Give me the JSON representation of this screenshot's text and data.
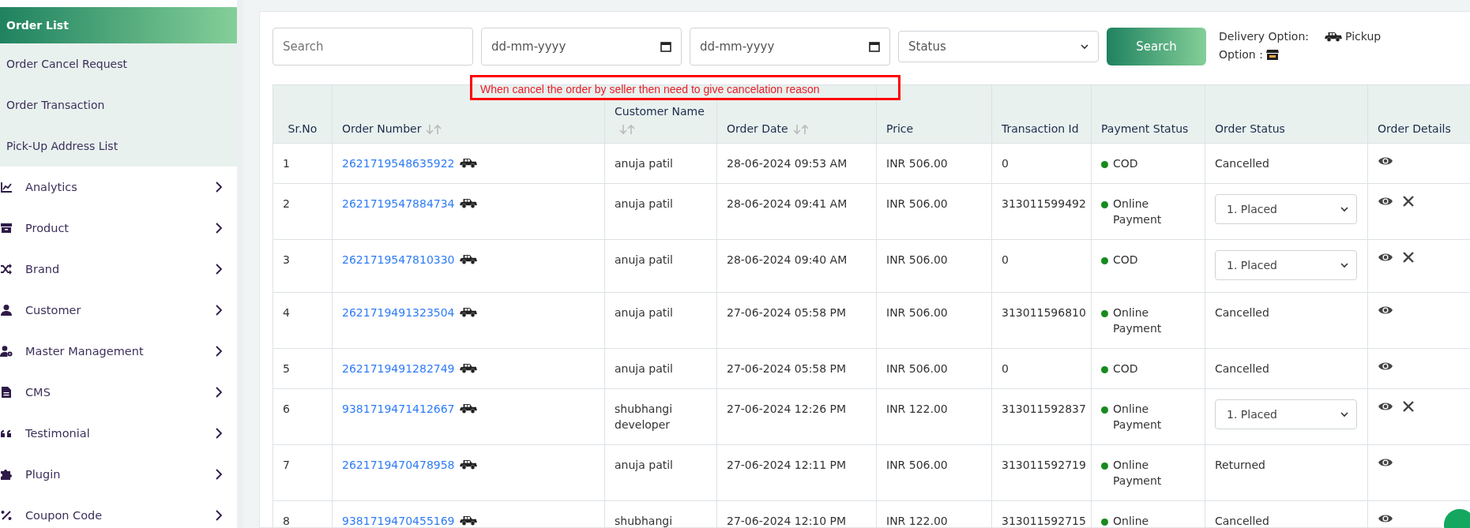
{
  "sidebar": {
    "submenu": [
      {
        "label": "Order List",
        "selected": true
      },
      {
        "label": "Order Cancel Request",
        "selected": false
      },
      {
        "label": "Order Transaction",
        "selected": false
      },
      {
        "label": "Pick-Up Address List",
        "selected": false
      }
    ],
    "items": [
      {
        "label": "Analytics"
      },
      {
        "label": "Product"
      },
      {
        "label": "Brand"
      },
      {
        "label": "Customer"
      },
      {
        "label": "Master Management"
      },
      {
        "label": "CMS"
      },
      {
        "label": "Testimonial"
      },
      {
        "label": "Plugin"
      },
      {
        "label": "Coupon Code"
      }
    ]
  },
  "filters": {
    "search": {
      "placeholder": "Search"
    },
    "date_from": {
      "placeholder": "dd-mm-yyyy"
    },
    "date_to": {
      "placeholder": "dd-mm-yyyy"
    },
    "status": {
      "value": "Status"
    },
    "search_button": "Search",
    "legend": {
      "delivery_label": "Delivery Option:",
      "pickup_label": "Pickup",
      "option_label": "Option :"
    }
  },
  "annotation": {
    "text": "When cancel the order by seller then need to give cancelation reason"
  },
  "table": {
    "columns": [
      {
        "label": "Sr.No",
        "sortable": false
      },
      {
        "label": "Order Number",
        "sortable": true
      },
      {
        "label": "Customer Name",
        "sortable": true
      },
      {
        "label": "Order Date",
        "sortable": true
      },
      {
        "label": "Price",
        "sortable": false
      },
      {
        "label": "Transaction Id",
        "sortable": false
      },
      {
        "label": "Payment Status",
        "sortable": false
      },
      {
        "label": "Order Status",
        "sortable": false
      },
      {
        "label": "Order Details",
        "sortable": false
      }
    ],
    "rows": [
      {
        "sr": "1",
        "order_number": "2621719548635922",
        "customer": "anuja patil",
        "date": "28-06-2024 09:53 AM",
        "price": "INR 506.00",
        "transaction_id": "0",
        "payment": "COD",
        "status": {
          "kind": "text",
          "value": "Cancelled"
        },
        "cancellable": false
      },
      {
        "sr": "2",
        "order_number": "2621719547884734",
        "customer": "anuja patil",
        "date": "28-06-2024 09:41 AM",
        "price": "INR 506.00",
        "transaction_id": "313011599492",
        "payment": "Online Payment",
        "status": {
          "kind": "select",
          "value": "1. Placed"
        },
        "cancellable": true
      },
      {
        "sr": "3",
        "order_number": "2621719547810330",
        "customer": "anuja patil",
        "date": "28-06-2024 09:40 AM",
        "price": "INR 506.00",
        "transaction_id": "0",
        "payment": "COD",
        "status": {
          "kind": "select",
          "value": "1. Placed"
        },
        "cancellable": true
      },
      {
        "sr": "4",
        "order_number": "2621719491323504",
        "customer": "anuja patil",
        "date": "27-06-2024 05:58 PM",
        "price": "INR 506.00",
        "transaction_id": "313011596810",
        "payment": "Online Payment",
        "status": {
          "kind": "text",
          "value": "Cancelled"
        },
        "cancellable": false
      },
      {
        "sr": "5",
        "order_number": "2621719491282749",
        "customer": "anuja patil",
        "date": "27-06-2024 05:58 PM",
        "price": "INR 506.00",
        "transaction_id": "0",
        "payment": "COD",
        "status": {
          "kind": "text",
          "value": "Cancelled"
        },
        "cancellable": false
      },
      {
        "sr": "6",
        "order_number": "9381719471412667",
        "customer": "shubhangi developer",
        "date": "27-06-2024 12:26 PM",
        "price": "INR 122.00",
        "transaction_id": "313011592837",
        "payment": "Online Payment",
        "status": {
          "kind": "select",
          "value": "1. Placed"
        },
        "cancellable": true
      },
      {
        "sr": "7",
        "order_number": "2621719470478958",
        "customer": "anuja patil",
        "date": "27-06-2024 12:11 PM",
        "price": "INR 506.00",
        "transaction_id": "313011592719",
        "payment": "Online Payment",
        "status": {
          "kind": "text",
          "value": "Returned"
        },
        "cancellable": false
      },
      {
        "sr": "8",
        "order_number": "9381719470455169",
        "customer": "shubhangi",
        "date": "27-06-2024 12:10 PM",
        "price": "INR 122.00",
        "transaction_id": "313011592715",
        "payment": "Online",
        "status": {
          "kind": "text",
          "value": "Cancelled"
        },
        "cancellable": false
      }
    ]
  }
}
